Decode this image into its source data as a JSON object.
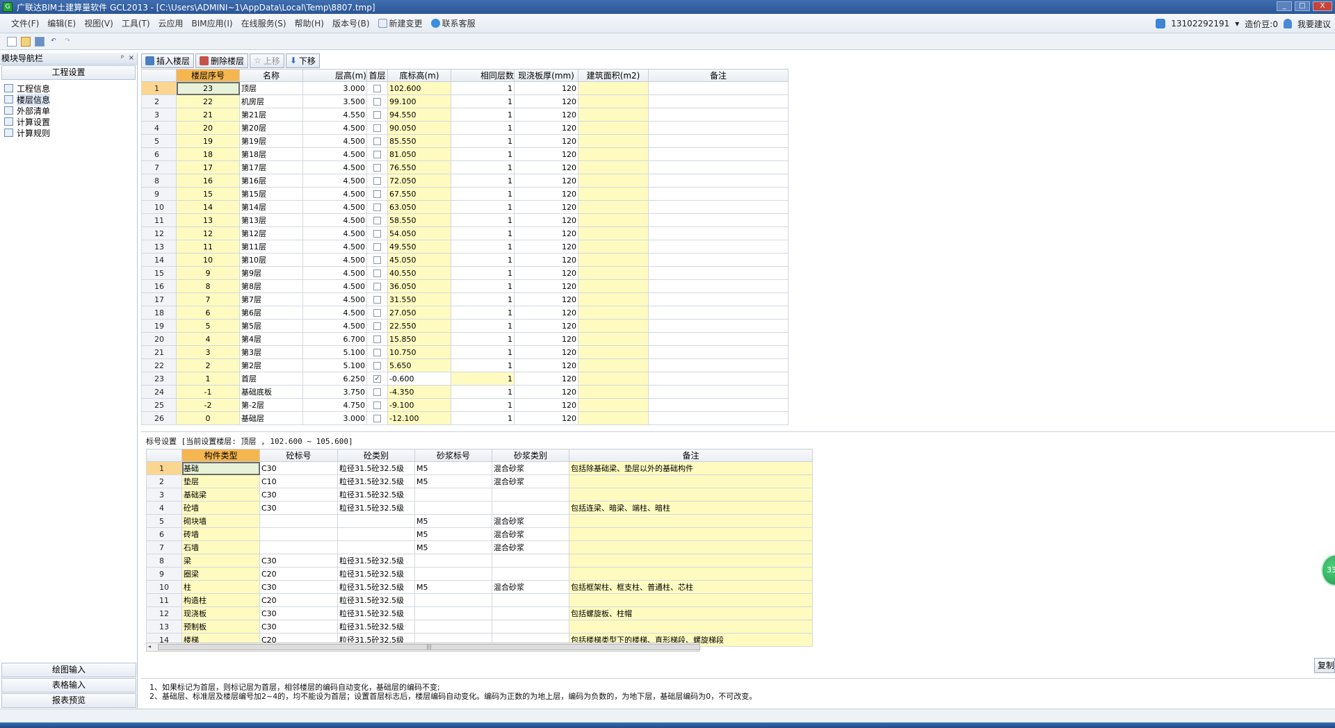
{
  "window": {
    "title": "广联达BIM土建算量软件 GCL2013 - [C:\\Users\\ADMINI~1\\AppData\\Local\\Temp\\8807.tmp]",
    "app_icon": "G",
    "minimize": "_",
    "maximize": "□",
    "close": "X"
  },
  "menubar": {
    "items": [
      "文件(F)",
      "编辑(E)",
      "视图(V)",
      "工具(T)",
      "云应用",
      "BIM应用(I)",
      "在线服务(S)",
      "帮助(H)",
      "版本号(B)"
    ],
    "new_change": "新建变更",
    "contact_service": "联系客服",
    "user_account": "13102292191",
    "cost_beans": "造价豆:0",
    "suggest": "我要建议"
  },
  "toolbar": {
    "icons": [
      "new-file-icon",
      "open-folder-icon",
      "save-icon",
      "undo-icon",
      "redo-icon"
    ]
  },
  "nav": {
    "title": "模块导航栏",
    "pin": "ᵖ",
    "close": "×",
    "section_project": "工程设置",
    "tree": [
      "工程信息",
      "楼层信息",
      "外部清单",
      "计算设置",
      "计算规则"
    ],
    "bottom_sections": [
      "绘图输入",
      "表格输入",
      "报表预览"
    ]
  },
  "floor_toolbar": {
    "insert": "插入楼层",
    "delete": "删除楼层",
    "move_up": "上移",
    "move_down": "下移"
  },
  "floor_table": {
    "headers": [
      "楼层序号",
      "名称",
      "层高(m)",
      "首层",
      "底标高(m)",
      "相同层数",
      "现浇板厚(mm)",
      "建筑面积(m2)",
      "备注"
    ],
    "rows": [
      {
        "n": "1",
        "seq": "23",
        "name": "顶层",
        "h": "3.000",
        "first": false,
        "base": "102.600",
        "same": "1",
        "slab": "120"
      },
      {
        "n": "2",
        "seq": "22",
        "name": "机房层",
        "h": "3.500",
        "first": false,
        "base": "99.100",
        "same": "1",
        "slab": "120"
      },
      {
        "n": "3",
        "seq": "21",
        "name": "第21层",
        "h": "4.550",
        "first": false,
        "base": "94.550",
        "same": "1",
        "slab": "120"
      },
      {
        "n": "4",
        "seq": "20",
        "name": "第20层",
        "h": "4.500",
        "first": false,
        "base": "90.050",
        "same": "1",
        "slab": "120"
      },
      {
        "n": "5",
        "seq": "19",
        "name": "第19层",
        "h": "4.500",
        "first": false,
        "base": "85.550",
        "same": "1",
        "slab": "120"
      },
      {
        "n": "6",
        "seq": "18",
        "name": "第18层",
        "h": "4.500",
        "first": false,
        "base": "81.050",
        "same": "1",
        "slab": "120"
      },
      {
        "n": "7",
        "seq": "17",
        "name": "第17层",
        "h": "4.500",
        "first": false,
        "base": "76.550",
        "same": "1",
        "slab": "120"
      },
      {
        "n": "8",
        "seq": "16",
        "name": "第16层",
        "h": "4.500",
        "first": false,
        "base": "72.050",
        "same": "1",
        "slab": "120"
      },
      {
        "n": "9",
        "seq": "15",
        "name": "第15层",
        "h": "4.500",
        "first": false,
        "base": "67.550",
        "same": "1",
        "slab": "120"
      },
      {
        "n": "10",
        "seq": "14",
        "name": "第14层",
        "h": "4.500",
        "first": false,
        "base": "63.050",
        "same": "1",
        "slab": "120"
      },
      {
        "n": "11",
        "seq": "13",
        "name": "第13层",
        "h": "4.500",
        "first": false,
        "base": "58.550",
        "same": "1",
        "slab": "120"
      },
      {
        "n": "12",
        "seq": "12",
        "name": "第12层",
        "h": "4.500",
        "first": false,
        "base": "54.050",
        "same": "1",
        "slab": "120"
      },
      {
        "n": "13",
        "seq": "11",
        "name": "第11层",
        "h": "4.500",
        "first": false,
        "base": "49.550",
        "same": "1",
        "slab": "120"
      },
      {
        "n": "14",
        "seq": "10",
        "name": "第10层",
        "h": "4.500",
        "first": false,
        "base": "45.050",
        "same": "1",
        "slab": "120"
      },
      {
        "n": "15",
        "seq": "9",
        "name": "第9层",
        "h": "4.500",
        "first": false,
        "base": "40.550",
        "same": "1",
        "slab": "120"
      },
      {
        "n": "16",
        "seq": "8",
        "name": "第8层",
        "h": "4.500",
        "first": false,
        "base": "36.050",
        "same": "1",
        "slab": "120"
      },
      {
        "n": "17",
        "seq": "7",
        "name": "第7层",
        "h": "4.500",
        "first": false,
        "base": "31.550",
        "same": "1",
        "slab": "120"
      },
      {
        "n": "18",
        "seq": "6",
        "name": "第6层",
        "h": "4.500",
        "first": false,
        "base": "27.050",
        "same": "1",
        "slab": "120"
      },
      {
        "n": "19",
        "seq": "5",
        "name": "第5层",
        "h": "4.500",
        "first": false,
        "base": "22.550",
        "same": "1",
        "slab": "120"
      },
      {
        "n": "20",
        "seq": "4",
        "name": "第4层",
        "h": "6.700",
        "first": false,
        "base": "15.850",
        "same": "1",
        "slab": "120"
      },
      {
        "n": "21",
        "seq": "3",
        "name": "第3层",
        "h": "5.100",
        "first": false,
        "base": "10.750",
        "same": "1",
        "slab": "120"
      },
      {
        "n": "22",
        "seq": "2",
        "name": "第2层",
        "h": "5.100",
        "first": false,
        "base": "5.650",
        "same": "1",
        "slab": "120"
      },
      {
        "n": "23",
        "seq": "1",
        "name": "首层",
        "h": "6.250",
        "first": true,
        "base": "-0.600",
        "same": "1",
        "slab": "120"
      },
      {
        "n": "24",
        "seq": "-1",
        "name": "基础底板",
        "h": "3.750",
        "first": false,
        "base": "-4.350",
        "same": "1",
        "slab": "120"
      },
      {
        "n": "25",
        "seq": "-2",
        "name": "第-2层",
        "h": "4.750",
        "first": false,
        "base": "-9.100",
        "same": "1",
        "slab": "120"
      },
      {
        "n": "26",
        "seq": "0",
        "name": "基础层",
        "h": "3.000",
        "first": false,
        "base": "-12.100",
        "same": "1",
        "slab": "120"
      }
    ]
  },
  "label_setting": "标号设置 [当前设置楼层: 顶层 , 102.600 ~ 105.600]",
  "grade_table": {
    "headers": [
      "构件类型",
      "砼标号",
      "砼类别",
      "砂浆标号",
      "砂浆类别",
      "备注"
    ],
    "rows": [
      {
        "n": "1",
        "type": "基础",
        "c": "C30",
        "ct": "粒径31.5砼32.5级",
        "m": "M5",
        "mt": "混合砂浆",
        "note": "包括除基础梁、垫层以外的基础构件"
      },
      {
        "n": "2",
        "type": "垫层",
        "c": "C10",
        "ct": "粒径31.5砼32.5级",
        "m": "M5",
        "mt": "混合砂浆",
        "note": ""
      },
      {
        "n": "3",
        "type": "基础梁",
        "c": "C30",
        "ct": "粒径31.5砼32.5级",
        "m": "",
        "mt": "",
        "note": ""
      },
      {
        "n": "4",
        "type": "砼墙",
        "c": "C30",
        "ct": "粒径31.5砼32.5级",
        "m": "",
        "mt": "",
        "note": "包括连梁、暗梁、端柱、暗柱"
      },
      {
        "n": "5",
        "type": "砌块墙",
        "c": "",
        "ct": "",
        "m": "M5",
        "mt": "混合砂浆",
        "note": ""
      },
      {
        "n": "6",
        "type": "砖墙",
        "c": "",
        "ct": "",
        "m": "M5",
        "mt": "混合砂浆",
        "note": ""
      },
      {
        "n": "7",
        "type": "石墙",
        "c": "",
        "ct": "",
        "m": "M5",
        "mt": "混合砂浆",
        "note": ""
      },
      {
        "n": "8",
        "type": "梁",
        "c": "C30",
        "ct": "粒径31.5砼32.5级",
        "m": "",
        "mt": "",
        "note": ""
      },
      {
        "n": "9",
        "type": "圈梁",
        "c": "C20",
        "ct": "粒径31.5砼32.5级",
        "m": "",
        "mt": "",
        "note": ""
      },
      {
        "n": "10",
        "type": "柱",
        "c": "C30",
        "ct": "粒径31.5砼32.5级",
        "m": "M5",
        "mt": "混合砂浆",
        "note": "包括框架柱、框支柱、普通柱、芯柱"
      },
      {
        "n": "11",
        "type": "构造柱",
        "c": "C20",
        "ct": "粒径31.5砼32.5级",
        "m": "",
        "mt": "",
        "note": ""
      },
      {
        "n": "12",
        "type": "现浇板",
        "c": "C30",
        "ct": "粒径31.5砼32.5级",
        "m": "",
        "mt": "",
        "note": "包括螺旋板、柱帽"
      },
      {
        "n": "13",
        "type": "预制板",
        "c": "C30",
        "ct": "粒径31.5砼32.5级",
        "m": "",
        "mt": "",
        "note": ""
      },
      {
        "n": "14",
        "type": "楼梯",
        "c": "C20",
        "ct": "粒径31.5砼32.5级",
        "m": "",
        "mt": "",
        "note": "包括楼梯类型下的楼梯、直形梯段、螺旋梯段"
      }
    ]
  },
  "copy_button": "复制",
  "notes": [
    "1、如果标记为首层，则标记层为首层，相邻楼层的编码自动变化，基础层的编码不变;",
    "2、基础层、标准层及楼层编号加2~4的，均不能设为首层；设置首层标志后，楼层编码自动变化。编码为正数的为地上层，编码为负数的，为地下层，基础层编码为0，不可改变。"
  ],
  "bubble": "33",
  "colors": {
    "header_highlight": "#f6b64f",
    "editable_cell": "#fffbc0",
    "titlebar": "#2c5596"
  }
}
